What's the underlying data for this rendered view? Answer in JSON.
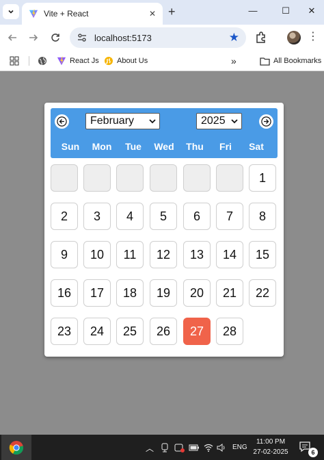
{
  "browser": {
    "tab_title": "Vite + React",
    "url": "localhost:5173",
    "bookmarks": [
      {
        "label": "React Js"
      },
      {
        "label": "About Us"
      }
    ],
    "overflow_label": "»",
    "all_bookmarks_label": "All Bookmarks"
  },
  "calendar": {
    "month": "February",
    "year": "2025",
    "weekdays": [
      "Sun",
      "Mon",
      "Tue",
      "Wed",
      "Thu",
      "Fri",
      "Sat"
    ],
    "leading_blank_days": 6,
    "days": [
      "1",
      "2",
      "3",
      "4",
      "5",
      "6",
      "7",
      "8",
      "9",
      "10",
      "11",
      "12",
      "13",
      "14",
      "15",
      "16",
      "17",
      "18",
      "19",
      "20",
      "21",
      "22",
      "23",
      "24",
      "25",
      "26",
      "27",
      "28"
    ],
    "highlighted_day": "27",
    "colors": {
      "header": "#4a9be6",
      "highlight": "#f0634a",
      "empty_cell": "#eeeeee"
    }
  },
  "taskbar": {
    "language": "ENG",
    "time": "11:00 PM",
    "date": "27-02-2025",
    "notification_count": "6"
  },
  "icons": {
    "tab_list": "chevron-down-icon",
    "favicon": "vite-icon",
    "site_info": "site-info-icon",
    "bookmark_star": "star-icon",
    "extensions": "puzzle-icon",
    "apps": "apps-grid-icon",
    "globe": "globe-icon",
    "folder": "folder-icon",
    "prev": "arrow-left-icon",
    "next": "arrow-right-icon"
  }
}
